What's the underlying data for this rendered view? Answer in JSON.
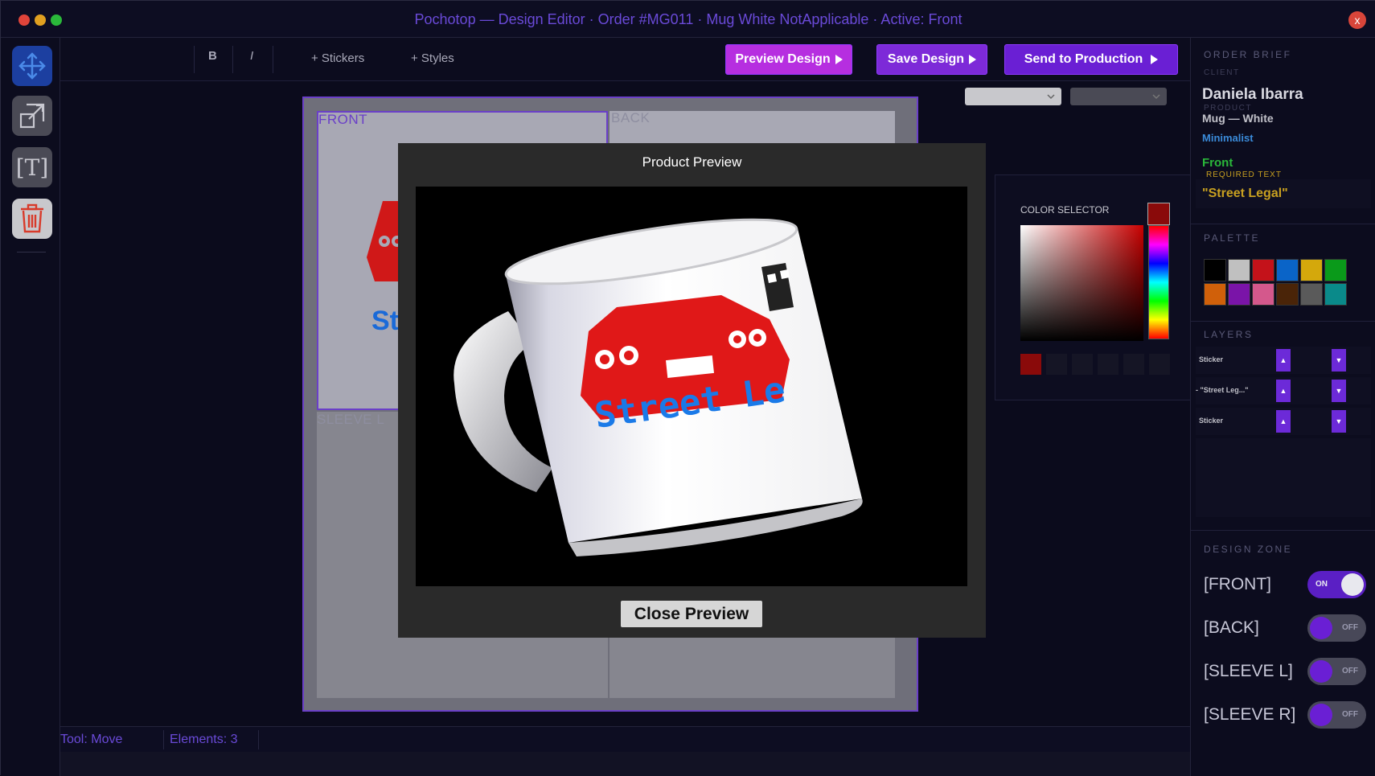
{
  "window": {
    "title": "Pochotop — Design Editor · Order #MG011 · Mug White NotApplicable · Active: Front",
    "close_label": "x"
  },
  "toolbar": {
    "bold": "B",
    "italic": "I",
    "stickers": "+ Stickers",
    "styles": "+ Styles",
    "preview_label": "Preview Design",
    "save_label": "Save Design",
    "send_label": "Send to Production"
  },
  "tools": [
    "move-icon",
    "resize-icon",
    "text-icon",
    "trash-icon"
  ],
  "canvas": {
    "front_label": "FRONT",
    "back_label": "BACK",
    "sleeve_label": "SLEEVE L",
    "preview_text": "St"
  },
  "modal": {
    "title": "Product Preview",
    "mug_text": "Street Le",
    "close_label": "Close Preview"
  },
  "color_selector": {
    "label": "COLOR SELECTOR",
    "current": "#8a0a0a"
  },
  "order_brief": {
    "heading": "ORDER BRIEF",
    "client_label": "CLIENT",
    "client": "Daniela Ibarra",
    "product_label": "PRODUCT",
    "product": "Mug — White",
    "style": "Minimalist",
    "zone": "Front",
    "required_label": "REQUIRED TEXT",
    "required_text": "\"Street Legal\""
  },
  "palette": {
    "heading": "PALETTE",
    "colors": [
      "#000000",
      "#c0c0c0",
      "#c4121a",
      "#0a64c8",
      "#d4a80c",
      "#0a9a1a",
      "#d0600a",
      "#7a14a8",
      "#d4588c",
      "#4a2408",
      "#5a5a5a",
      "#0a8a8a"
    ]
  },
  "layers": {
    "heading": "LAYERS",
    "items": [
      {
        "name": "Sticker"
      },
      {
        "name": "- \"Street Leg...\""
      },
      {
        "name": "Sticker"
      }
    ],
    "up": "▲",
    "down": "▼"
  },
  "design_zone": {
    "heading": "DESIGN ZONE",
    "zones": [
      {
        "name": "[FRONT]",
        "state": "ON"
      },
      {
        "name": "[BACK]",
        "state": "OFF"
      },
      {
        "name": "[SLEEVE L]",
        "state": "OFF"
      },
      {
        "name": "[SLEEVE R]",
        "state": "OFF"
      }
    ]
  },
  "status": {
    "tool": "Tool: Move",
    "elements": "Elements: 3"
  },
  "colors": {
    "accent": "#6a4ad8",
    "preview_button": "#b62ee0",
    "save_button": "#7d2ad8",
    "send_button": "#6a1fd4",
    "toggle_on": "#5a1fc4"
  }
}
